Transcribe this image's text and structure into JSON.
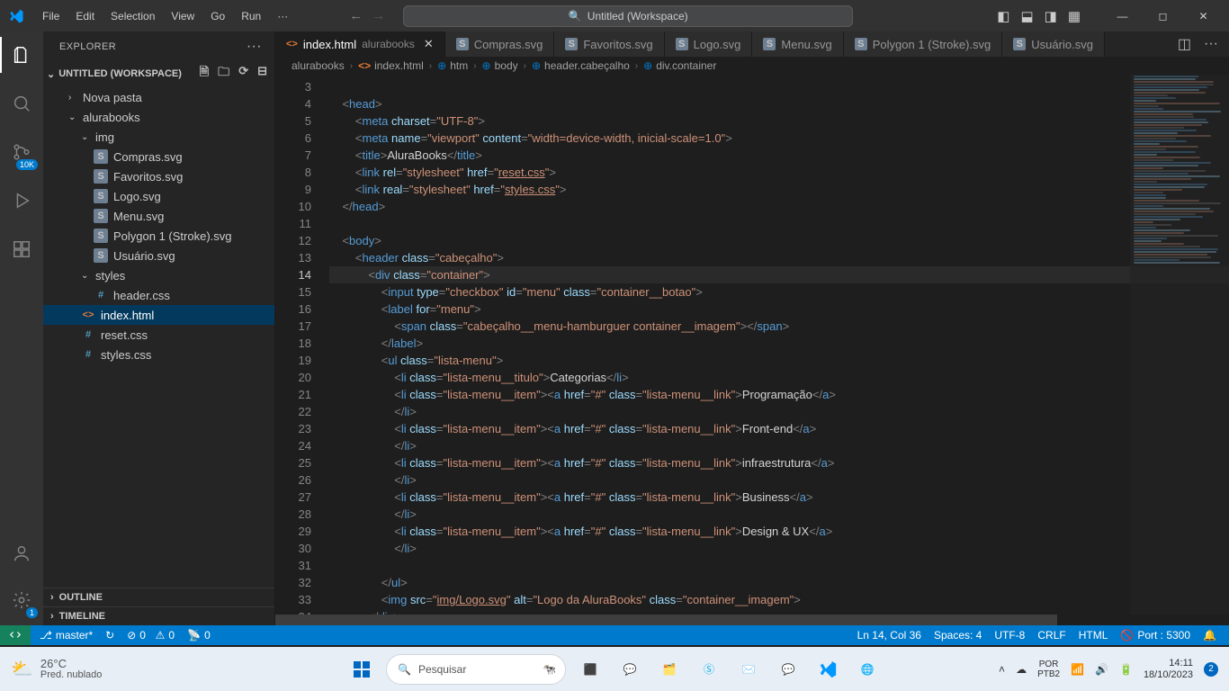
{
  "titlebar": {
    "menus": [
      "File",
      "Edit",
      "Selection",
      "View",
      "Go",
      "Run"
    ],
    "search": "Untitled (Workspace)"
  },
  "activitybar": {
    "scm_badge": "10K",
    "settings_badge": "1"
  },
  "sidebar": {
    "title": "EXPLORER",
    "workspace": "UNTITLED (WORKSPACE)",
    "tree": {
      "novapasta": "Nova pasta",
      "alurabooks": "alurabooks",
      "img": "img",
      "files_img": [
        "Compras.svg",
        "Favoritos.svg",
        "Logo.svg",
        "Menu.svg",
        "Polygon 1 (Stroke).svg",
        "Usuário.svg"
      ],
      "styles": "styles",
      "styles_file": "header.css",
      "root_files": {
        "index": "index.html",
        "reset": "reset.css",
        "styles": "styles.css"
      }
    },
    "outline": "OUTLINE",
    "timeline": "TIMELINE"
  },
  "tabs": [
    {
      "label": "index.html",
      "hint": "alurabooks",
      "icon": "html",
      "active": true
    },
    {
      "label": "Compras.svg",
      "icon": "svg"
    },
    {
      "label": "Favoritos.svg",
      "icon": "svg"
    },
    {
      "label": "Logo.svg",
      "icon": "svg"
    },
    {
      "label": "Menu.svg",
      "icon": "svg"
    },
    {
      "label": "Polygon 1 (Stroke).svg",
      "icon": "svg"
    },
    {
      "label": "Usuário.svg",
      "icon": "svg"
    }
  ],
  "breadcrumbs": [
    "alurabooks",
    "index.html",
    "htm",
    "body",
    "header.cabeçalho",
    "div.container"
  ],
  "code": {
    "start": 3,
    "current": 14
  },
  "status": {
    "branch": "master*",
    "sync": "↻",
    "errors": "0",
    "warnings": "0",
    "radio": "0",
    "ln": "Ln 14, Col 36",
    "spaces": "Spaces: 4",
    "enc": "UTF-8",
    "eol": "CRLF",
    "lang": "HTML",
    "port": "Port : 5300"
  },
  "taskbar": {
    "temp": "26°C",
    "cond": "Pred. nublado",
    "search": "Pesquisar",
    "lang1": "POR",
    "lang2": "PTB2",
    "time": "14:11",
    "date": "18/10/2023",
    "notif": "2"
  }
}
